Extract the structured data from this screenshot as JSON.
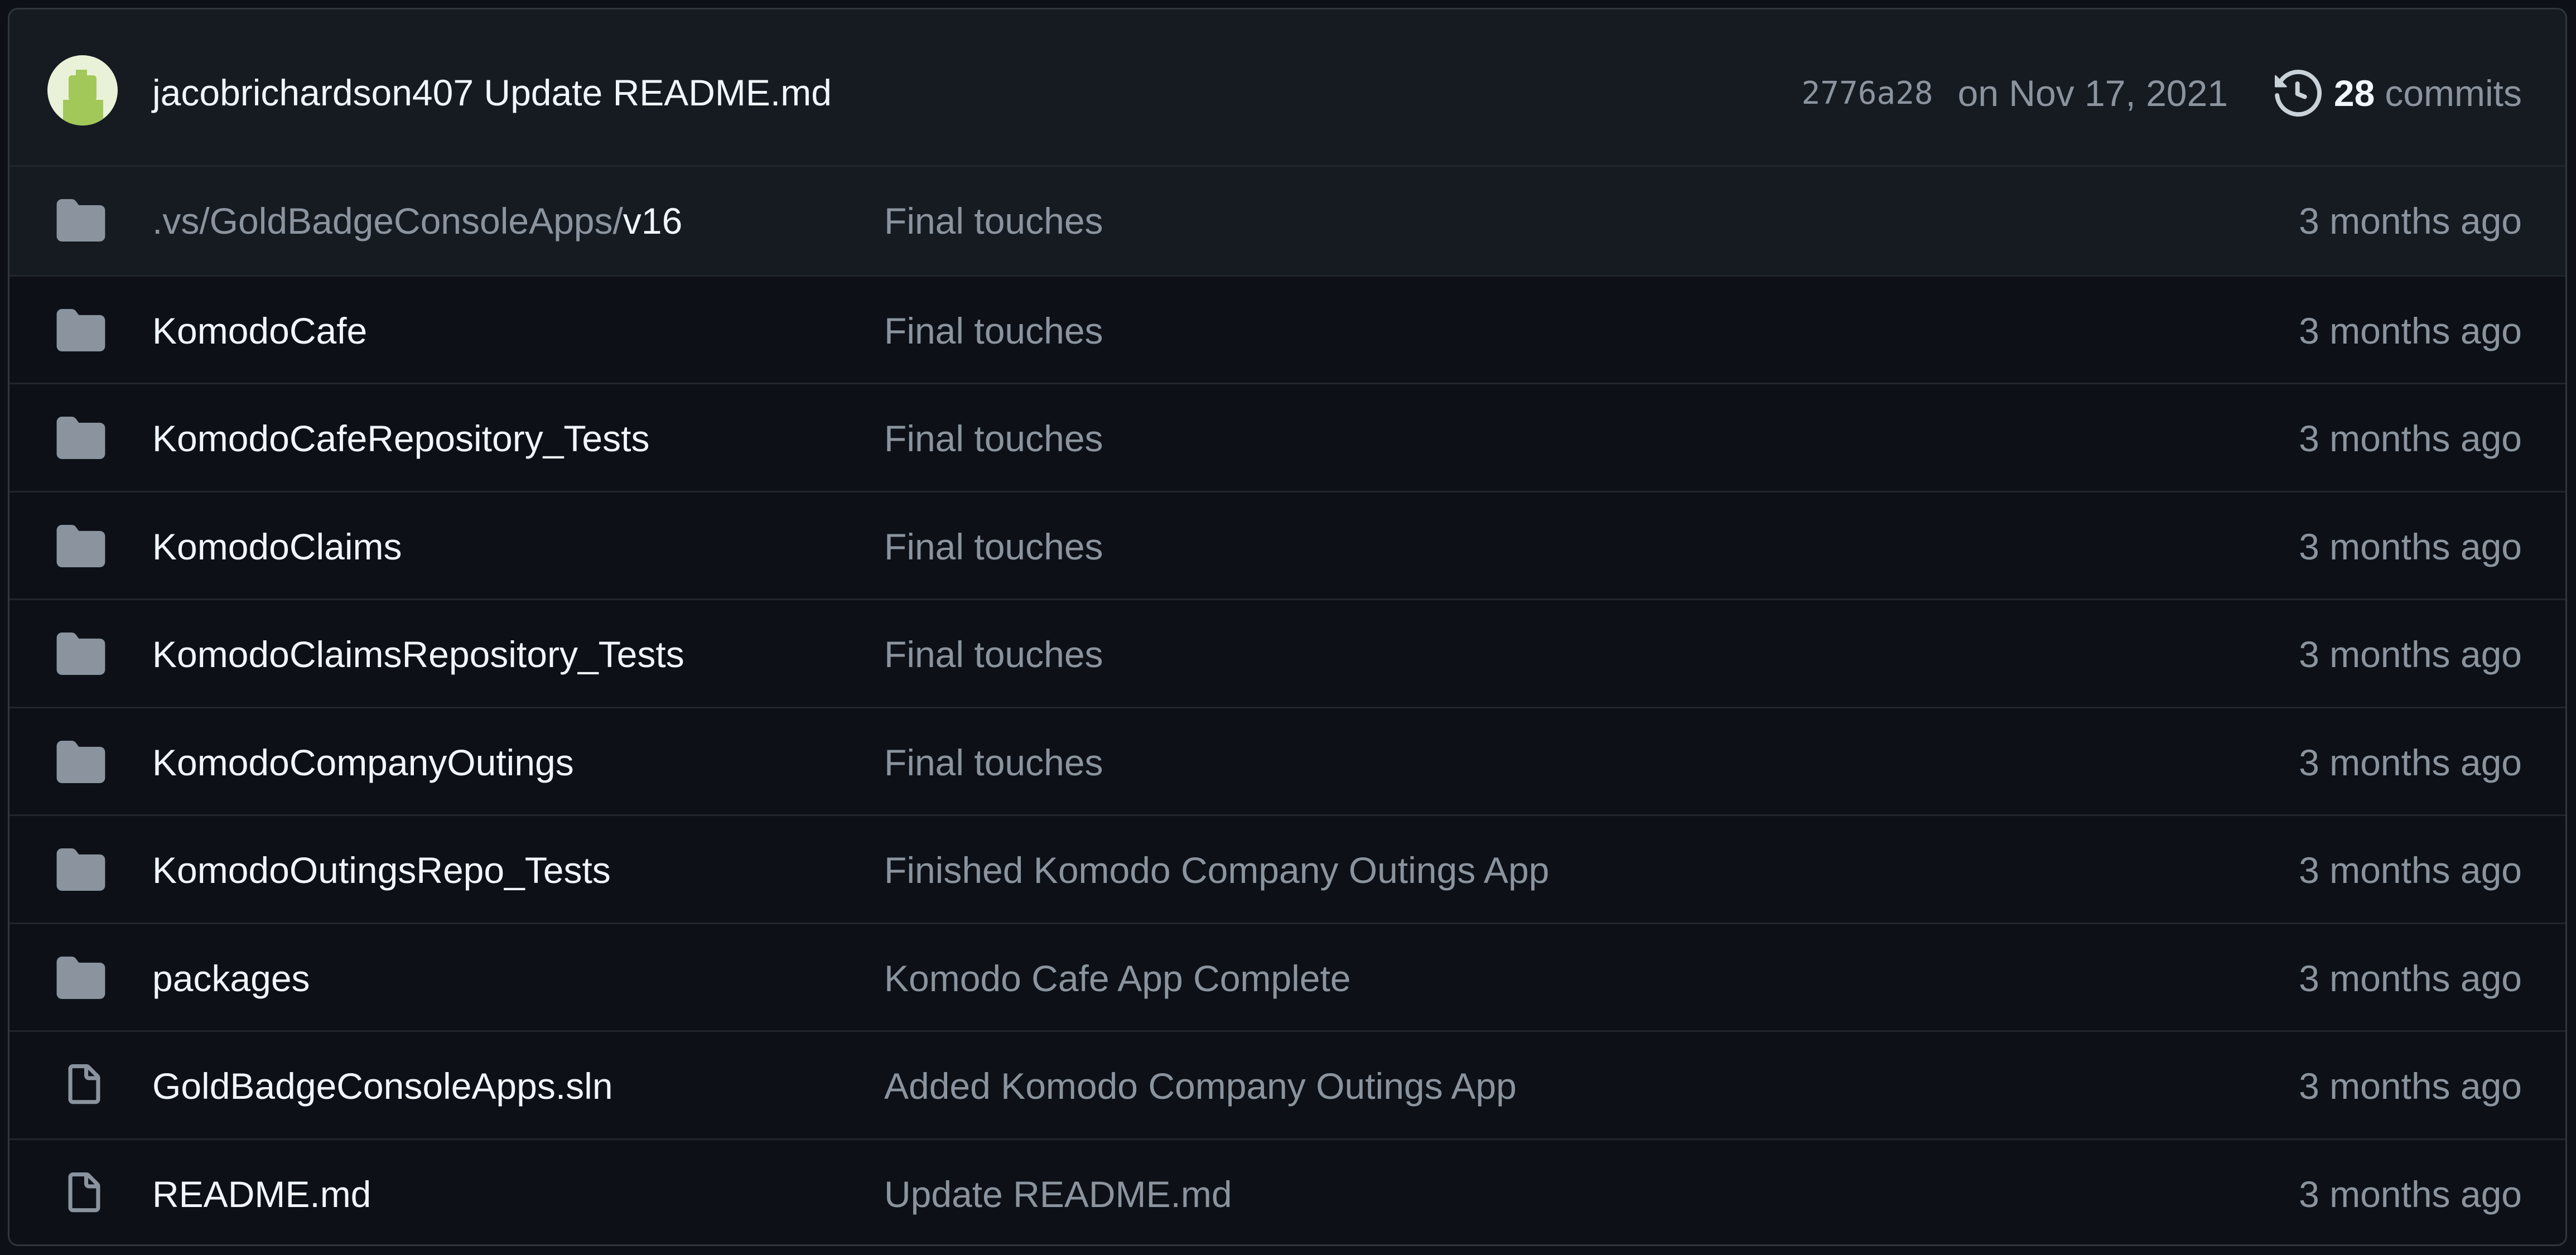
{
  "commit_bar": {
    "author": "jacobrichardson407",
    "message": "Update README.md",
    "sha": "2776a28",
    "date": "on Nov 17, 2021",
    "commit_count": "28",
    "commit_word": "commits",
    "history_icon": "history-icon"
  },
  "files": [
    {
      "type": "folder",
      "icon": "folder-icon",
      "name_prefix": ".vs/GoldBadgeConsoleApps/",
      "name": "v16",
      "message": "Final touches",
      "age": "3 months ago"
    },
    {
      "type": "folder",
      "icon": "folder-icon",
      "name_prefix": "",
      "name": "KomodoCafe",
      "message": "Final touches",
      "age": "3 months ago"
    },
    {
      "type": "folder",
      "icon": "folder-icon",
      "name_prefix": "",
      "name": "KomodoCafeRepository_Tests",
      "message": "Final touches",
      "age": "3 months ago"
    },
    {
      "type": "folder",
      "icon": "folder-icon",
      "name_prefix": "",
      "name": "KomodoClaims",
      "message": "Final touches",
      "age": "3 months ago"
    },
    {
      "type": "folder",
      "icon": "folder-icon",
      "name_prefix": "",
      "name": "KomodoClaimsRepository_Tests",
      "message": "Final touches",
      "age": "3 months ago"
    },
    {
      "type": "folder",
      "icon": "folder-icon",
      "name_prefix": "",
      "name": "KomodoCompanyOutings",
      "message": "Final touches",
      "age": "3 months ago"
    },
    {
      "type": "folder",
      "icon": "folder-icon",
      "name_prefix": "",
      "name": "KomodoOutingsRepo_Tests",
      "message": "Finished Komodo Company Outings App",
      "age": "3 months ago"
    },
    {
      "type": "folder",
      "icon": "folder-icon",
      "name_prefix": "",
      "name": "packages",
      "message": "Komodo Cafe App Complete",
      "age": "3 months ago"
    },
    {
      "type": "file",
      "icon": "file-icon",
      "name_prefix": "",
      "name": "GoldBadgeConsoleApps.sln",
      "message": "Added Komodo Company Outings App",
      "age": "3 months ago"
    },
    {
      "type": "file",
      "icon": "file-icon",
      "name_prefix": "",
      "name": "README.md",
      "message": "Update README.md",
      "age": "3 months ago"
    }
  ],
  "colors": {
    "background": "#0d1117",
    "header_background": "#161b22",
    "border": "#30363d",
    "primary_text": "#f0f6fc",
    "muted_text": "#8b949e",
    "icon": "#8b949e"
  }
}
